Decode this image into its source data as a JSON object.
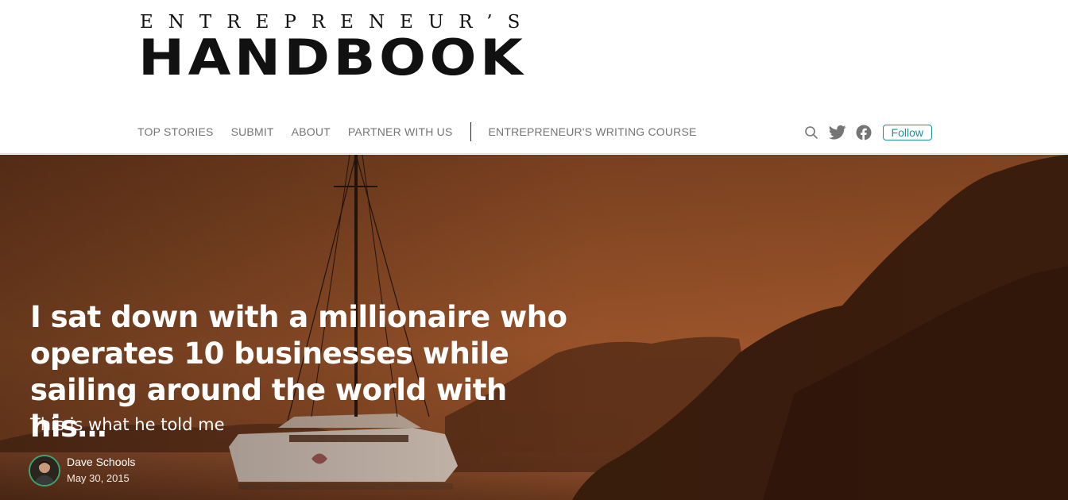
{
  "logo": {
    "top_text": "ENTREPRENEUR’S",
    "main_text": "HANDBOOK"
  },
  "nav": {
    "items": [
      {
        "label": "TOP STORIES"
      },
      {
        "label": "SUBMIT"
      },
      {
        "label": "ABOUT"
      },
      {
        "label": "PARTNER WITH US"
      },
      {
        "label": "ENTREPRENEUR'S WRITING COURSE"
      }
    ]
  },
  "actions": {
    "icons": [
      "search-icon",
      "twitter-icon",
      "facebook-icon"
    ],
    "follow_label": "Follow"
  },
  "hero": {
    "title": "I sat down with a millionaire who operates 10 businesses while sailing around the world with his…",
    "subtitle": "This is what he told me",
    "author_name": "Dave Schools",
    "date": "May 30, 2015"
  },
  "colors": {
    "accent": "#1a8f96",
    "nav_text": "#757575",
    "hero_tint": "#8a4a28",
    "avatar_ring": "#3ea36f"
  }
}
